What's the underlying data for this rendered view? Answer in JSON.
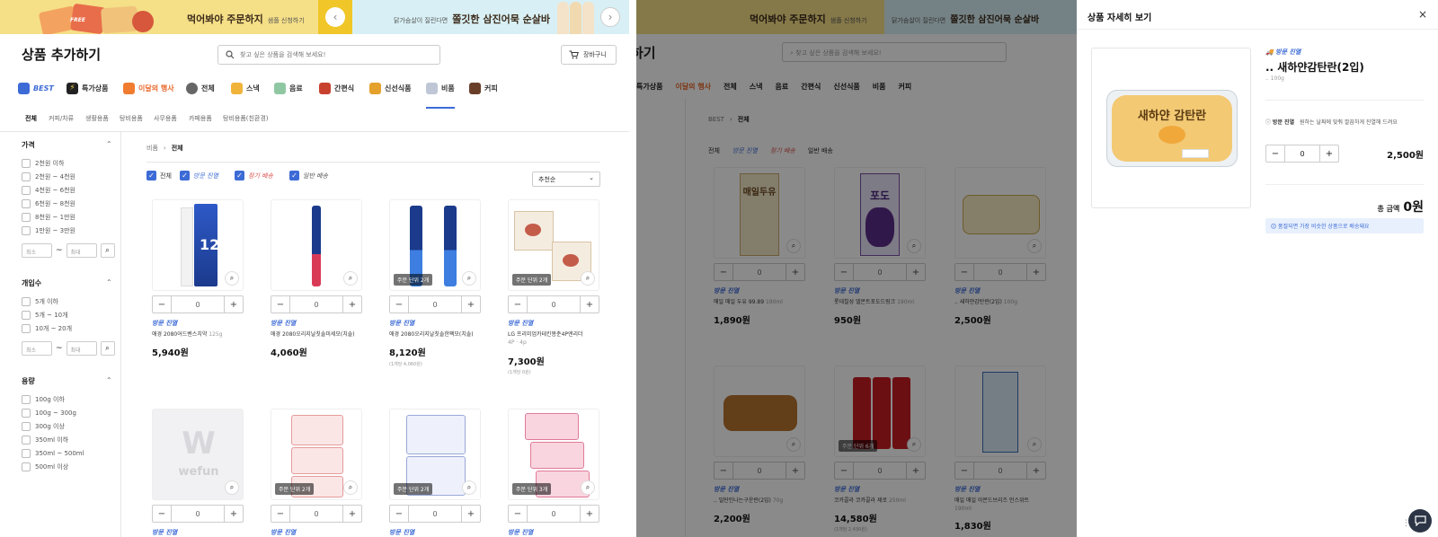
{
  "banners": [
    {
      "title": "먹어봐야 주문하지",
      "sub": "샘플 신청하기",
      "badge": "FREE"
    },
    {
      "title": "쫄깃한 삼진어묵 순살바",
      "pre": "닭가슴살이 질린다면"
    }
  ],
  "header": {
    "title": "상품 추가하기",
    "search_placeholder": "찾고 싶은 상품을 검색해 보세요!",
    "cart_label": "장바구니"
  },
  "categories": [
    {
      "label": "BEST"
    },
    {
      "label": "특가상품"
    },
    {
      "label": "이달의 행사"
    },
    {
      "label": "전체"
    },
    {
      "label": "스낵"
    },
    {
      "label": "음료"
    },
    {
      "label": "간편식"
    },
    {
      "label": "신선식품"
    },
    {
      "label": "비품"
    },
    {
      "label": "커피"
    }
  ],
  "subcategories": [
    "전체",
    "커피/차류",
    "생활용품",
    "탕비용품",
    "사무용품",
    "카페용품",
    "탕비용품(친환경)"
  ],
  "filters": {
    "price": {
      "title": "가격",
      "options": [
        "2천원 이하",
        "2천원 ~ 4천원",
        "4천원 ~ 6천원",
        "6천원 ~ 8천원",
        "8천원 ~ 1만원",
        "1만원 ~ 3만원"
      ],
      "min": "최소",
      "max": "최대"
    },
    "count": {
      "title": "개입수",
      "options": [
        "5개 이하",
        "5개 ~ 10개",
        "10개 ~ 20개"
      ],
      "min": "최소",
      "max": "최대"
    },
    "volume": {
      "title": "용량",
      "options": [
        "100g 이하",
        "100g ~ 300g",
        "300g 이상",
        "350ml 이하",
        "350ml ~ 500ml",
        "500ml 이상"
      ]
    }
  },
  "breadcrumb": [
    "비품",
    "전체"
  ],
  "delivery_filters": [
    "전체",
    "방문 진열",
    "정기 배송",
    "일반 배송"
  ],
  "sort": "추천순",
  "products": [
    {
      "name": "애경 2080어드벤스치약",
      "weight": "125g",
      "price": "5,940원",
      "qty": "0",
      "badge": "방문 진열",
      "unit": ""
    },
    {
      "name": "애경 2080오리지날칫솔미세모(치솔)",
      "weight": "",
      "price": "4,060원",
      "qty": "0",
      "badge": "방문 진열",
      "unit": ""
    },
    {
      "name": "애경 2080오리지날칫솔한팩모(치솔)",
      "weight": "",
      "price": "8,120원",
      "ppu": "(1개당 4,060원)",
      "qty": "0",
      "badge": "방문 진열",
      "unit": "주문 단위 2개"
    },
    {
      "name": "LG 프리미엄카테킨봉춘4P엔리더",
      "weight": "4P · 4p",
      "price": "7,300원",
      "ppu": "(1개당 0원)",
      "qty": "0",
      "badge": "방문 진열",
      "unit": "주문 단위 2개"
    },
    {
      "name": "",
      "weight": "",
      "price": "",
      "qty": "0",
      "badge": "방문 진열",
      "unit": "",
      "placeholder": "wefun"
    },
    {
      "name": "",
      "weight": "",
      "price": "",
      "qty": "0",
      "badge": "방문 진열",
      "unit": "주문 단위 2개"
    },
    {
      "name": "",
      "weight": "",
      "price": "",
      "qty": "0",
      "badge": "방문 진열",
      "unit": "주문 단위 2개"
    },
    {
      "name": "",
      "weight": "",
      "price": "",
      "qty": "0",
      "badge": "방문 진열",
      "unit": "주문 단위 3개"
    }
  ],
  "mid_products": [
    {
      "name": "매일 매일 두유 99.89",
      "weight": "190ml",
      "price": "1,890원",
      "qty": "0",
      "badge": "방문 진열",
      "label": "매일두유"
    },
    {
      "name": "롯데칠성 델몬트포도드링크",
      "weight": "190ml",
      "price": "950원",
      "qty": "0",
      "badge": "방문 진열",
      "label": "포도"
    },
    {
      "name": ".. 새하얀감탄란(2입)",
      "weight": "100g",
      "price": "2,500원",
      "qty": "0",
      "badge": "방문 진열"
    },
    {
      "name": ".. 밀탄인나는구운란(2입)",
      "weight": "70g",
      "price": "2,200원",
      "qty": "0",
      "badge": "방문 진열"
    },
    {
      "name": "코카콜라 코카콜라 제로",
      "weight": "250ml",
      "price": "14,580원",
      "ppu": "(1개당 2,430원)",
      "qty": "0",
      "badge": "방문 진열",
      "unit": "주문 단위 6개"
    },
    {
      "name": "매일 매일 아몬드브리즈 언스위트",
      "weight": "190ml",
      "price": "1,830원",
      "qty": "0",
      "badge": "방문 진열"
    }
  ],
  "mid_breadcrumb": [
    "BEST",
    "전체"
  ],
  "mid_cats": [
    "특가상품",
    "이달의 행사",
    "전체",
    "스낵",
    "음료",
    "간편식",
    "신선식품",
    "비품",
    "커피"
  ],
  "detail": {
    "title": "상품 자세히 보기",
    "badge": "방문 진열",
    "name": ".. 새하얀감탄란(2입)",
    "weight": ".. 100g",
    "visit_label": "방문 진열",
    "visit_desc": "원하는 날짜에 맞춰 깔끔하게 진열해 드려요",
    "qty": "0",
    "price": "2,500원",
    "total_label": "총 금액",
    "total_value": "0원",
    "notice": "품절되면 가장 비슷한 상품으로 배송돼요",
    "egg_text": "새하얀 감탄란"
  },
  "colors": {
    "accent": "#3d6bd6",
    "banner1": "#f5df87",
    "banner2": "#d8f0f5"
  }
}
